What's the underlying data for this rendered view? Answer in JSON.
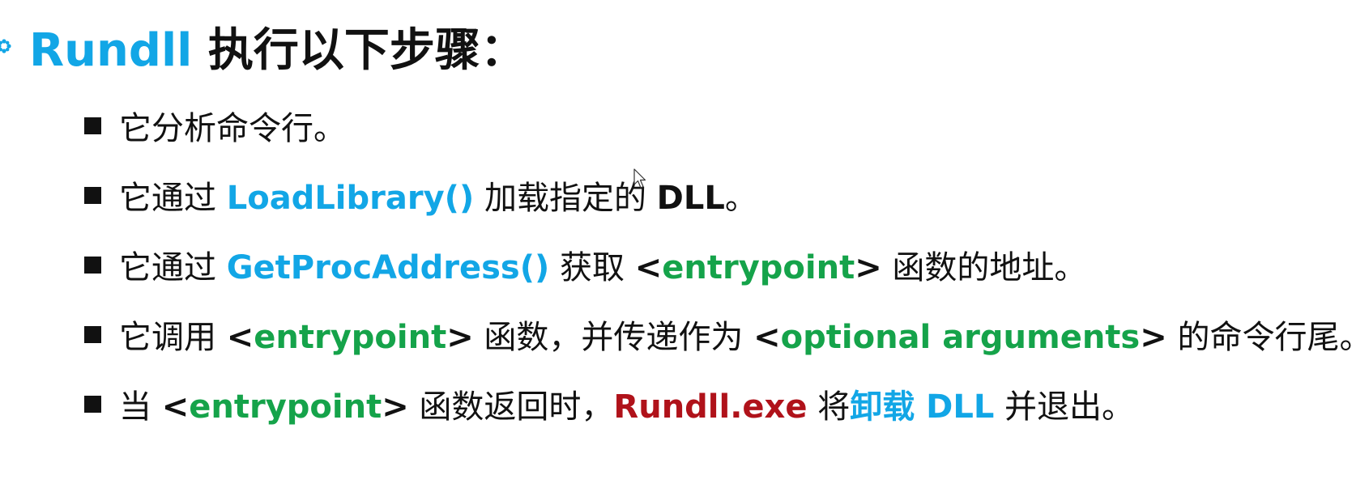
{
  "title": {
    "part1": "Rundll",
    "part2": " 执行以下步骤："
  },
  "steps": [
    {
      "segments": [
        {
          "text": "它分析命令行。",
          "style": "plain"
        }
      ]
    },
    {
      "segments": [
        {
          "text": "它通过 ",
          "style": "plain"
        },
        {
          "text": "LoadLibrary()",
          "style": "blue"
        },
        {
          "text": " 加载指定的 ",
          "style": "plain"
        },
        {
          "text": "DLL",
          "style": "bold"
        },
        {
          "text": "。",
          "style": "plain"
        }
      ]
    },
    {
      "segments": [
        {
          "text": "它通过 ",
          "style": "plain"
        },
        {
          "text": "GetProcAddress()",
          "style": "blue"
        },
        {
          "text": " 获取 ",
          "style": "plain"
        },
        {
          "text": "<",
          "style": "bold"
        },
        {
          "text": "entrypoint",
          "style": "green"
        },
        {
          "text": ">",
          "style": "bold"
        },
        {
          "text": " 函数的地址。",
          "style": "plain"
        }
      ]
    },
    {
      "segments": [
        {
          "text": "它调用 ",
          "style": "plain"
        },
        {
          "text": "<",
          "style": "bold"
        },
        {
          "text": "entrypoint",
          "style": "green"
        },
        {
          "text": ">",
          "style": "bold"
        },
        {
          "text": " 函数，并传递作为 ",
          "style": "plain"
        },
        {
          "text": "<",
          "style": "bold"
        },
        {
          "text": "optional arguments",
          "style": "green"
        },
        {
          "text": ">",
          "style": "bold"
        },
        {
          "text": " 的命令行尾。",
          "style": "plain"
        }
      ]
    },
    {
      "segments": [
        {
          "text": "当 ",
          "style": "plain"
        },
        {
          "text": "<",
          "style": "bold"
        },
        {
          "text": "entrypoint",
          "style": "green"
        },
        {
          "text": ">",
          "style": "bold"
        },
        {
          "text": " 函数返回时，",
          "style": "plain"
        },
        {
          "text": "Rundll.exe",
          "style": "red"
        },
        {
          "text": " 将",
          "style": "plain"
        },
        {
          "text": "卸载 DLL",
          "style": "blue"
        },
        {
          "text": " 并退出。",
          "style": "plain"
        }
      ]
    }
  ],
  "colors": {
    "accent_blue": "#12a6e6",
    "accent_green": "#15a34a",
    "accent_red": "#b0121a",
    "text": "#111111"
  },
  "icons": {
    "title_bullet": "flower-bullet-icon",
    "list_bullet": "square-bullet-icon",
    "cursor": "mouse-pointer-icon"
  }
}
